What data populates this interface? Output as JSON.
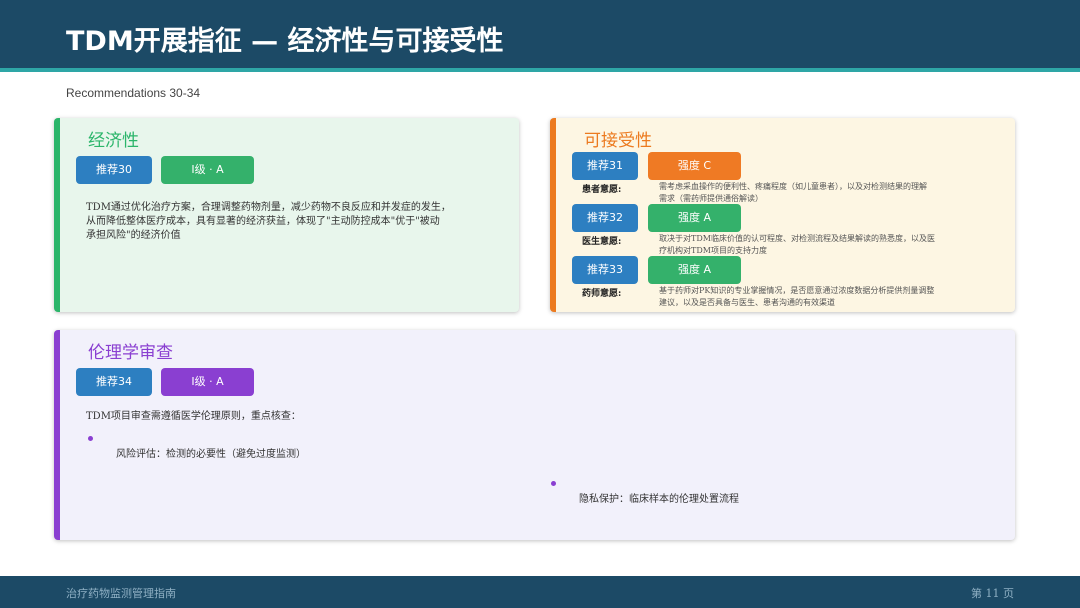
{
  "header": {
    "title": "TDM开展指征 — 经济性与可接受性"
  },
  "subtitle": "Recommendations 30-34",
  "economy": {
    "title": "经济性",
    "rec_label": "推荐30",
    "grade_label": "Ⅰ级 · A",
    "text_line1": "TDM通过优化治疗方案，合理调整药物剂量，减少药物不良反应和并发症的发生，",
    "text_line2": "从而降低整体医疗成本，具有显著的经济获益，体现了\"主动防控成本\"优于\"被动",
    "text_line3": "承担风险\"的经济价值",
    "colors": {
      "accent": "#2bb56a",
      "background": "#e8f6ec"
    }
  },
  "acceptability": {
    "title": "可接受性",
    "items": [
      {
        "rec_label": "推荐31",
        "strength_label": "强度 C",
        "role": "患者意愿:",
        "desc_line1": "需考虑采血操作的便利性、疼痛程度（如儿童患者），以及对检测结果的理解",
        "desc_line2": "需求（需药师提供通俗解读）"
      },
      {
        "rec_label": "推荐32",
        "strength_label": "强度 A",
        "role": "医生意愿:",
        "desc_line1": "取决于对TDM临床价值的认可程度、对检测流程及结果解读的熟悉度，以及医",
        "desc_line2": "疗机构对TDM项目的支持力度"
      },
      {
        "rec_label": "推荐33",
        "strength_label": "强度 A",
        "role": "药师意愿:",
        "desc_line1": "基于药师对PK知识的专业掌握情况，是否愿意通过浓度数据分析提供剂量调整",
        "desc_line2": "建议，以及是否具备与医生、患者沟通的有效渠道"
      }
    ],
    "colors": {
      "accent": "#ec7a1f",
      "background": "#fdf6e3"
    }
  },
  "ethics": {
    "title": "伦理学审查",
    "rec_label": "推荐34",
    "grade_label": "Ⅰ级 · A",
    "intro": "TDM项目审查需遵循医学伦理原则，重点核查：",
    "bullet1": "风险评估：检测的必要性（避免过度监测）",
    "bullet2": "隐私保护：临床样本的伦理处置流程",
    "colors": {
      "accent": "#8a3fd1",
      "background": "#f2f1fb"
    }
  },
  "footer": {
    "left": "治疗药物监测管理指南",
    "right": "第 11 页"
  }
}
